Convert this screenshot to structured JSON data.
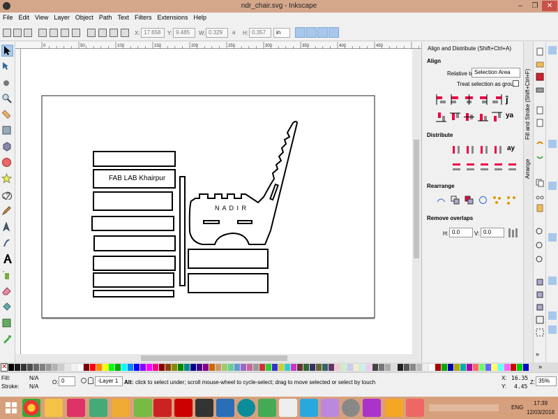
{
  "window": {
    "title": "ndr_chair.svg - Inkscape",
    "minimize": "–",
    "maximize": "❐",
    "close": "✕"
  },
  "menu": [
    "File",
    "Edit",
    "View",
    "Layer",
    "Object",
    "Path",
    "Text",
    "Filters",
    "Extensions",
    "Help"
  ],
  "controls": {
    "x_label": "X:",
    "x_value": "17.658",
    "y_label": "Y:",
    "y_value": "9.485",
    "w_label": "W:",
    "w_value": "0.329",
    "lock_label": "a",
    "h_label": "H:",
    "h_value": "0.357",
    "unit": "in"
  },
  "ruler_ticks": [
    "0",
    "50",
    "100",
    "150",
    "200",
    "250",
    "300",
    "350",
    "400",
    "450"
  ],
  "canvas": {
    "text_label": "FAB LAB Khairpur",
    "chair_label": "N A D I R"
  },
  "dock": {
    "title": "Align and Distribute (Shift+Ctrl+A)",
    "align_header": "Align",
    "relative_to_label": "Relative to:",
    "relative_to_value": "Selection Area",
    "treat_group_label": "Treat selection as group:",
    "distribute_header": "Distribute",
    "rearrange_header": "Rearrange",
    "remove_overlaps_header": "Remove overlaps",
    "h_label": "H:",
    "h_value": "0.0",
    "v_label": "V:",
    "v_value": "0.0"
  },
  "vtabs": [
    "Fill and Stroke (Shift+Ctrl+F)",
    "Arrange"
  ],
  "status": {
    "fill_label": "Fill:",
    "fill_value": "N/A",
    "stroke_label": "Stroke:",
    "stroke_value": "N/A",
    "opacity_label": "O:",
    "opacity_value": "0",
    "layer": "-Layer 1",
    "message_bold": "Alt:",
    "message": " click to select under; scroll mouse-wheel to cycle-select; drag to move selected or select by touch",
    "x_label": "X:",
    "x_value": "16.35",
    "y_label": "Y:",
    "y_value": "4.45",
    "zoom_label": "Z:",
    "zoom_value": "35%"
  },
  "taskbar": {
    "lang": "ENG",
    "time": "17:39",
    "date": "12/03/2018"
  },
  "colors": {
    "accent": "#a7c8ea",
    "titlebar": "#d4a68a",
    "taskbar": "#d7a07d"
  }
}
